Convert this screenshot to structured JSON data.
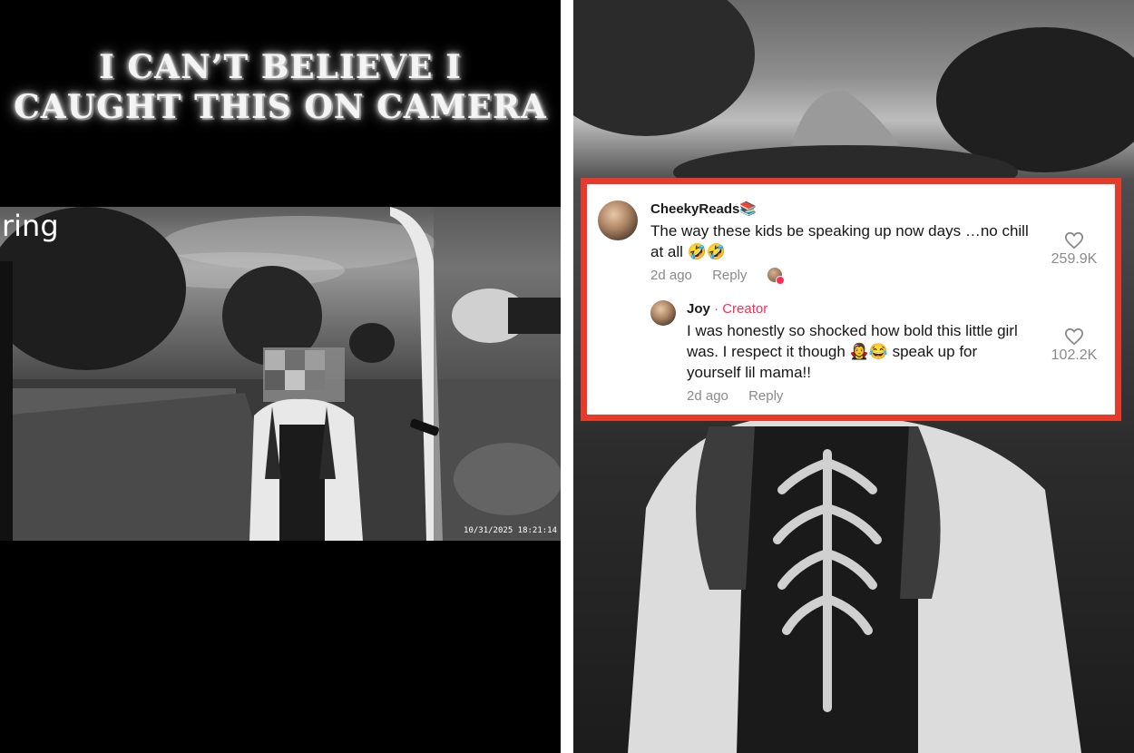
{
  "left_panel": {
    "caption_line1": "I can’t believe I",
    "caption_line2": "caught this on camera",
    "camera_brand": "ring",
    "timestamp": "10/31/2025 18:21:14"
  },
  "comments": [
    {
      "username": "CheekyReads📚",
      "text": "The way these kids be speaking up now days …no chill at all 🤣🤣",
      "age": "2d ago",
      "reply_label": "Reply",
      "likes": "259.9K",
      "icons": {
        "like": "heart-icon",
        "liked_by_creator": "creator-avatar-icon"
      }
    },
    {
      "username": "Joy",
      "separator": " · ",
      "badge": "Creator",
      "text": "I was honestly so shocked how bold this little girl was. I respect it though 🧛‍♀️😂 speak up for yourself lil mama!!",
      "age": "2d ago",
      "reply_label": "Reply",
      "likes": "102.2K",
      "icons": {
        "like": "heart-icon"
      }
    }
  ],
  "colors": {
    "highlight_border": "#e63a2a",
    "creator_badge": "#fe2c55",
    "meta_text": "#8a8a8a"
  }
}
